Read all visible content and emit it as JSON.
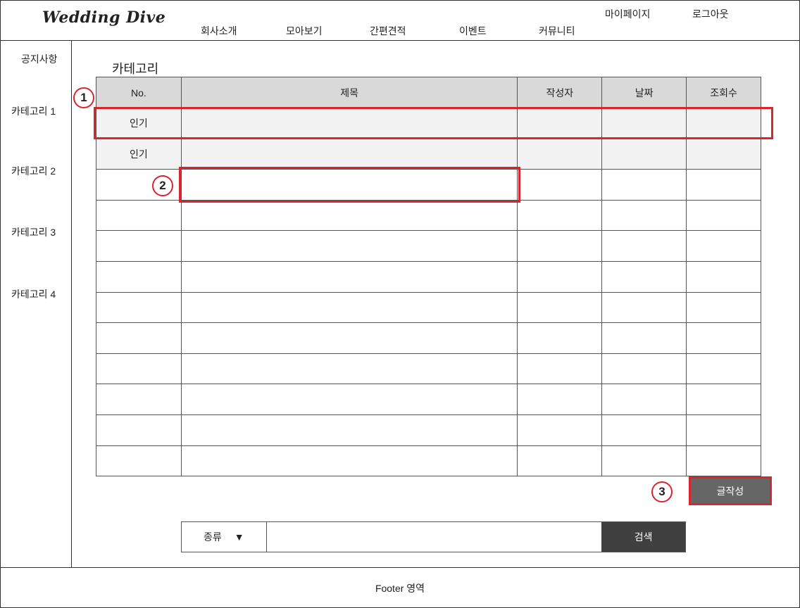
{
  "header": {
    "logo": "Wedding Dive",
    "nav": [
      "회사소개",
      "모아보기",
      "간편견적",
      "이벤트",
      "커뮤니티"
    ],
    "mypage": "마이페이지",
    "logout": "로그아웃"
  },
  "sidebar": {
    "items": [
      "공지사항",
      "카테고리 1",
      "카테고리 2",
      "카테고리 3",
      "카테고리 4"
    ]
  },
  "main": {
    "category_title": "카테고리",
    "table": {
      "headers": [
        "No.",
        "제목",
        "작성자",
        "날짜",
        "조회수"
      ],
      "popular_label": "인기"
    },
    "write_button": "글작성",
    "search": {
      "type_label": "종류",
      "dropdown_glyph": "▼",
      "input_value": "",
      "button": "검색"
    }
  },
  "markers": [
    "1",
    "2",
    "3"
  ],
  "footer": {
    "text": "Footer 영역"
  },
  "colors": {
    "highlight": "#d9262e",
    "header_row": "#d9d9d9",
    "button_dark": "#404040",
    "button_gray": "#666666"
  }
}
